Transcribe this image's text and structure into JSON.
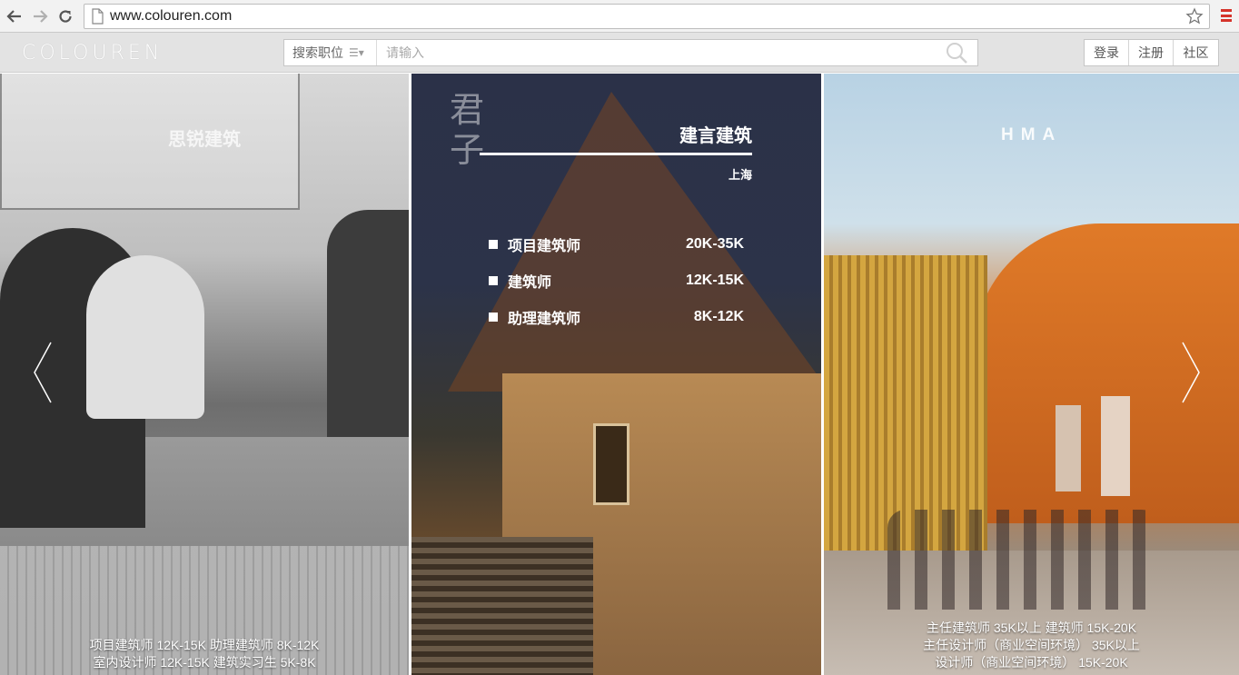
{
  "browser": {
    "url": "www.colouren.com",
    "back_icon": "back-arrow-icon",
    "forward_icon": "forward-arrow-icon",
    "reload_icon": "reload-icon"
  },
  "header": {
    "logo": "COLOUREN",
    "search": {
      "category_label": "搜索职位",
      "placeholder": "请输入"
    },
    "auth": {
      "login": "登录",
      "register": "注册",
      "community": "社区"
    }
  },
  "panels": {
    "left": {
      "company": "思锐建筑",
      "lines": [
        "项目建筑师 12K-15K    助理建筑师 8K-12K",
        "室内设计师 12K-15K    建筑实习生 5K-8K"
      ]
    },
    "middle": {
      "calligraphy": "君子",
      "company": "建言建筑",
      "city": "上海",
      "jobs": [
        {
          "title": "项目建筑师",
          "salary": "20K-35K"
        },
        {
          "title": "建筑师",
          "salary": "12K-15K"
        },
        {
          "title": "助理建筑师",
          "salary": "8K-12K"
        }
      ]
    },
    "right": {
      "company": "HMA",
      "lines": [
        "主任建筑师 35K以上    建筑师 15K-20K",
        "主任设计师（商业空间环境） 35K以上",
        "设计师（商业空间环境） 15K-20K"
      ]
    }
  },
  "colors": {
    "menu_accent": "#d5342b",
    "header_bg": "#e3e3e3"
  }
}
